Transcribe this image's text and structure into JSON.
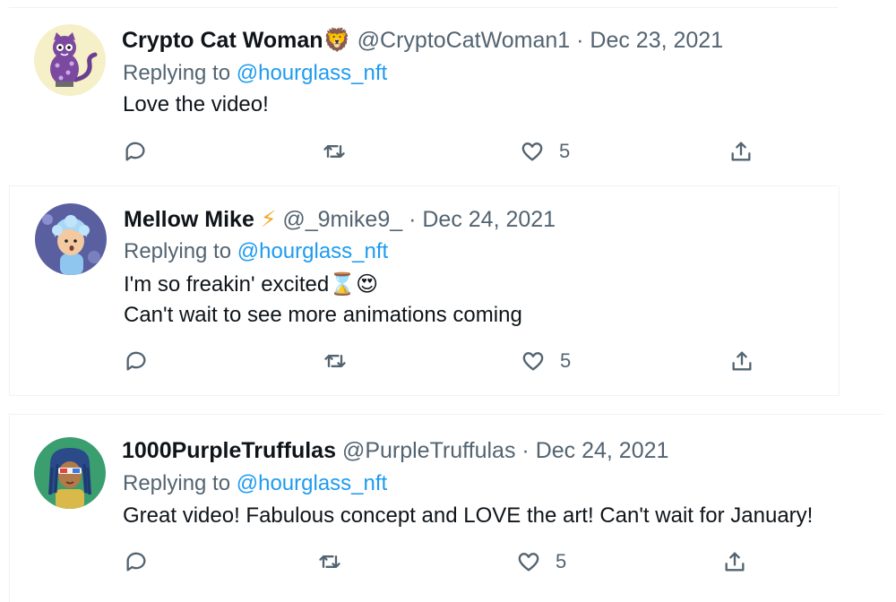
{
  "replies": [
    {
      "display_name": "Crypto Cat Woman",
      "name_emoji": "🦁",
      "handle": "@CryptoCatWoman1",
      "sep": "·",
      "date": "Dec 23, 2021",
      "replying_prefix": "Replying to",
      "replying_handle": "@hourglass_nft",
      "text_lines": [
        "Love the video!"
      ],
      "likes": "5",
      "avatar_icon": "purple-cat-monster-avatar",
      "avatar_bg": "#f5f0c8"
    },
    {
      "display_name": "Mellow Mike",
      "name_emoji": "⚡",
      "handle": "@_9mike9_",
      "sep": "·",
      "date": "Dec 24, 2021",
      "replying_prefix": "Replying to",
      "replying_handle": "@hourglass_nft",
      "text_lines": [
        "I'm so freakin' excited⌛😍",
        "Can't wait to see more animations coming"
      ],
      "likes": "5",
      "avatar_icon": "blue-haired-character-avatar",
      "avatar_bg": "#5a5fa0"
    },
    {
      "display_name": "1000PurpleTruffulas",
      "name_emoji": "",
      "handle": "@PurpleTruffulas",
      "sep": "·",
      "date": "Dec 24, 2021",
      "replying_prefix": "Replying to",
      "replying_handle": "@hourglass_nft",
      "text_lines": [
        "Great video! Fabulous concept and LOVE the art! Can't wait for January!"
      ],
      "likes": "5",
      "avatar_icon": "dreadlocks-character-avatar",
      "avatar_bg": "#3a9e6e"
    }
  ],
  "colors": {
    "link": "#1d9bf0",
    "muted": "#536471",
    "text": "#0f1419"
  }
}
